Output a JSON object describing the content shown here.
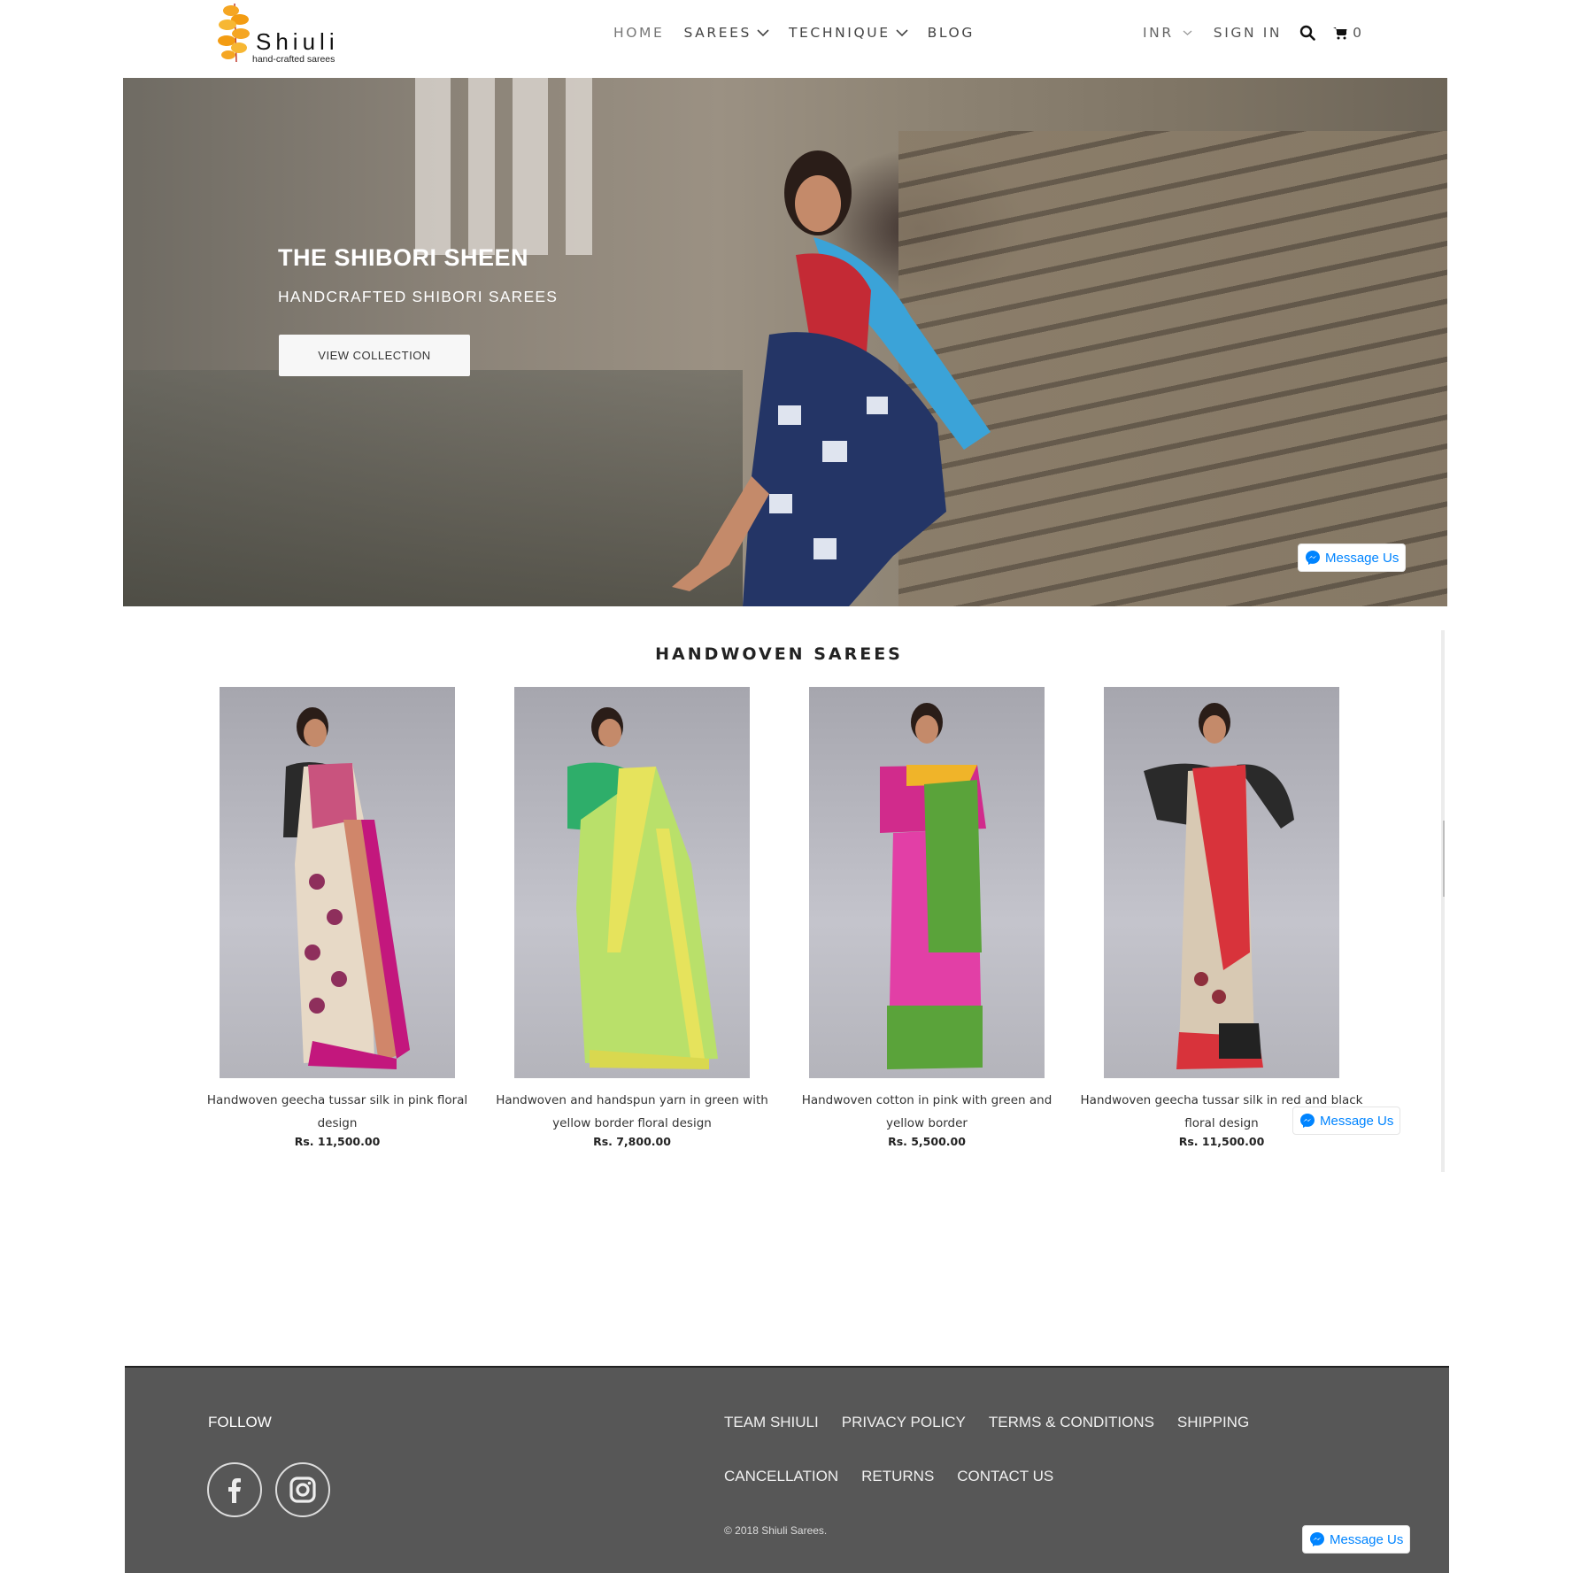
{
  "header": {
    "logo": {
      "name": "Shiuli",
      "tagline": "hand-crafted sarees"
    },
    "nav": [
      {
        "label": "HOME",
        "has_dropdown": false
      },
      {
        "label": "SAREES",
        "has_dropdown": true
      },
      {
        "label": "TECHNIQUE",
        "has_dropdown": true
      },
      {
        "label": "BLOG",
        "has_dropdown": false
      }
    ],
    "currency": "INR",
    "sign_in": "SIGN IN",
    "search_icon": "search-icon",
    "cart_icon": "cart-icon",
    "cart_count": "0"
  },
  "hero": {
    "title": "THE SHIBORI SHEEN",
    "subtitle": "HANDCRAFTED SHIBORI SAREES",
    "button": "VIEW COLLECTION"
  },
  "messenger": {
    "label": "Message Us",
    "icon": "messenger-icon",
    "color": "#0084ff"
  },
  "section": {
    "title": "HANDWOVEN SAREES",
    "products": [
      {
        "name": "Handwoven geecha tussar silk in pink floral design",
        "price": "Rs. 11,500.00"
      },
      {
        "name": "Handwoven and handspun yarn in green with yellow border floral design",
        "price": "Rs. 7,800.00"
      },
      {
        "name": "Handwoven cotton in pink with green and yellow border",
        "price": "Rs. 5,500.00"
      },
      {
        "name": "Handwoven geecha tussar silk in red and black floral design",
        "price": "Rs. 11,500.00"
      }
    ]
  },
  "footer": {
    "follow": "FOLLOW",
    "social": [
      "facebook-icon",
      "instagram-icon"
    ],
    "links_row1": [
      "TEAM SHIULI",
      "PRIVACY POLICY",
      "TERMS & CONDITIONS",
      "SHIPPING"
    ],
    "links_row2": [
      "CANCELLATION",
      "RETURNS",
      "CONTACT US"
    ],
    "copyright": "© 2018 Shiuli Sarees.",
    "background": "#575757"
  }
}
